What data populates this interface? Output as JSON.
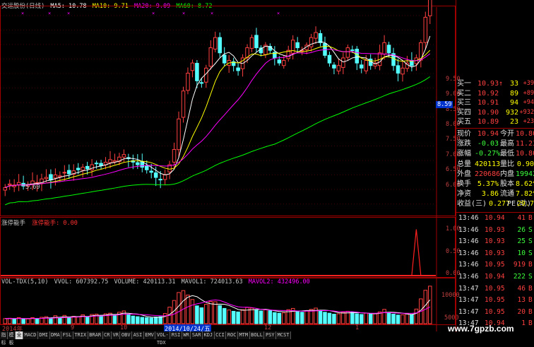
{
  "title": "交运股份(日线)",
  "ma_legend": [
    {
      "label": "MA5: 10.78",
      "color": "#ffffff"
    },
    {
      "label": "MA10: 9.71",
      "color": "#ffff00"
    },
    {
      "label": "MA20: 9.09",
      "color": "#ff00ff"
    },
    {
      "label": "MA60: 8.72",
      "color": "#00ff00"
    }
  ],
  "price_axis": [
    "9.50",
    "9.00",
    "8.50",
    "8.00",
    "7.50",
    "7.00",
    "6.50",
    "6.00"
  ],
  "current_price_tag": "8.59",
  "low_label": "5.69",
  "indicator_title": "涨停能手",
  "indicator_legend": "涨停能手: 0.00",
  "indicator_axis": [
    "1.00",
    "0.50",
    "0.00"
  ],
  "vol_legend": [
    {
      "label": "VOL-TDX(5,10)",
      "color": "#c8c8c8"
    },
    {
      "label": "VVOL: 607392.75",
      "color": "#c8c8c8"
    },
    {
      "label": "VOLUME: 420113.31",
      "color": "#c8c8c8"
    },
    {
      "label": "MAVOL1: 724013.63",
      "color": "#c8c8c8"
    },
    {
      "label": "MAVOL2: 432496.00",
      "color": "#ff00ff"
    }
  ],
  "vol_axis": [
    "10000",
    "5000"
  ],
  "date_axis": {
    "year": "2014年",
    "m9": "9",
    "m10": "10",
    "cursor": "2014/10/24/五",
    "m12": "12",
    "m1": "1"
  },
  "bid_ask": [
    {
      "label": "买一",
      "price": "10.93",
      "arrow": "↑",
      "vol": "33",
      "chg": "+39"
    },
    {
      "label": "买二",
      "price": "10.92",
      "arrow": "",
      "vol": "89",
      "chg": "+89"
    },
    {
      "label": "买三",
      "price": "10.91",
      "arrow": "",
      "vol": "94",
      "chg": "+94"
    },
    {
      "label": "买四",
      "price": "10.90",
      "arrow": "",
      "vol": "932",
      "chg": "+932"
    },
    {
      "label": "买五",
      "price": "10.89",
      "arrow": "",
      "vol": "23",
      "chg": "+23"
    }
  ],
  "stats": [
    {
      "l1": "现价",
      "v1": "10.94",
      "l2": "今开",
      "v2": "10.80"
    },
    {
      "l1": "涨跌",
      "v1": "-0.03",
      "l2": "最高",
      "v2": "11.23"
    },
    {
      "l1": "涨幅",
      "v1": "-0.27%",
      "l2": "最低",
      "v2": "10.80"
    },
    {
      "l1": "总量",
      "v1": "420113",
      "l2": "量比",
      "v2": "0.90"
    },
    {
      "l1": "外盘",
      "v1": "220686",
      "l2": "内盘",
      "v2": "199427"
    },
    {
      "l1": "换手",
      "v1": "5.37%",
      "l2": "股本",
      "v2": "8.62亿"
    },
    {
      "l1": "净资",
      "v1": "3.86",
      "l2": "流通",
      "v2": "7.82亿"
    },
    {
      "l1": "收益(三)",
      "v1": "0.277",
      "l2": "PE(动)",
      "v2": "29.7"
    }
  ],
  "ticks": [
    {
      "time": "13:46",
      "price": "10.94",
      "vol": "41",
      "side": "B"
    },
    {
      "time": "13:46",
      "price": "10.93",
      "vol": "26",
      "side": "S"
    },
    {
      "time": "13:46",
      "price": "10.93",
      "vol": "25",
      "side": "S"
    },
    {
      "time": "13:46",
      "price": "10.93",
      "vol": "10",
      "side": "S"
    },
    {
      "time": "13:46",
      "price": "10.95",
      "vol": "919",
      "side": "B"
    },
    {
      "time": "13:46",
      "price": "10.94",
      "vol": "222",
      "side": "S"
    },
    {
      "time": "13:47",
      "price": "10.95",
      "vol": "46",
      "side": "B"
    },
    {
      "time": "13:47",
      "price": "10.95",
      "vol": "13",
      "side": "B"
    },
    {
      "time": "13:47",
      "price": "10.95",
      "vol": "20",
      "side": "B"
    },
    {
      "time": "13:47",
      "price": "10.94",
      "vol": "1",
      "side": "B"
    }
  ],
  "tabs": [
    "指标",
    "模板",
    "全部",
    "MACD",
    "DMI",
    "DMA",
    "FSL",
    "TRIX",
    "BRAR",
    "CR",
    "VR",
    "OBV",
    "ASI",
    "EMV",
    "VOL-TDX",
    "RSI",
    "WR",
    "SAR",
    "KDJ",
    "CCI",
    "ROC",
    "MTM",
    "BOLL",
    "PSY",
    "MCST"
  ],
  "active_tab": "全部",
  "watermark": "www.7gpzb.com",
  "colors": {
    "up": "#ff4040",
    "down": "#54ffff",
    "ma5": "#ffffff",
    "ma10": "#ffff00",
    "ma20": "#ff00ff",
    "ma60": "#00ff00",
    "frame": "#a00000"
  },
  "chart_data": {
    "type": "candlestick",
    "ma_periods": [
      5,
      10,
      20,
      60
    ],
    "closes": [
      6.15,
      6.22,
      6.2,
      6.25,
      6.18,
      6.2,
      6.28,
      6.25,
      6.32,
      6.35,
      6.3,
      6.4,
      6.38,
      6.45,
      6.42,
      6.48,
      6.5,
      6.55,
      6.52,
      6.6,
      6.62,
      6.58,
      6.65,
      6.7,
      6.68,
      6.75,
      6.8,
      6.72,
      6.65,
      6.6,
      6.55,
      6.5,
      6.45,
      6.35,
      6.3,
      6.4,
      6.6,
      6.9,
      7.5,
      8.05,
      8.4,
      8.6,
      8.25,
      8.2,
      8.5,
      8.9,
      9.1,
      8.8,
      8.6,
      8.65,
      8.55,
      8.45,
      8.7,
      8.9,
      9.1,
      8.9,
      8.8,
      8.95,
      8.85,
      8.7,
      8.6,
      8.65,
      8.85,
      9.05,
      8.9,
      8.85,
      8.95,
      9.1,
      9.2,
      9.0,
      8.75,
      8.6,
      8.5,
      8.55,
      8.7,
      8.9,
      8.85,
      8.6,
      8.5,
      8.65,
      8.55,
      8.6,
      8.8,
      9.0,
      8.8,
      8.55,
      8.4,
      8.5,
      8.6,
      8.55,
      8.7,
      9.0,
      9.5,
      9.9
    ],
    "ylim": [
      5.6,
      9.7
    ],
    "volume": [
      1600,
      1700,
      1500,
      1900,
      1400,
      1500,
      1900,
      1600,
      2000,
      2200,
      1600,
      2500,
      1900,
      2600,
      2000,
      2300,
      2200,
      2800,
      2100,
      2900,
      3000,
      2400,
      3100,
      3300,
      2600,
      3600,
      4000,
      2900,
      2400,
      2200,
      2000,
      1900,
      1800,
      2100,
      2200,
      3200,
      5200,
      7300,
      9800,
      10400,
      9000,
      7600,
      5600,
      5000,
      6100,
      7000,
      6900,
      5700,
      4800,
      4300,
      3900,
      3700,
      4400,
      5100,
      4900,
      4300,
      4000,
      4400,
      4100,
      3500,
      3300,
      3400,
      4400,
      4800,
      3900,
      3600,
      4000,
      4500,
      4900,
      4200,
      3600,
      3300,
      3000,
      3100,
      3600,
      3900,
      3600,
      3100,
      2900,
      3300,
      3100,
      3200,
      3700,
      4500,
      3500,
      3000,
      2700,
      2800,
      3100,
      2900,
      4600,
      7800,
      10500,
      11800
    ],
    "vol_ylim": [
      0,
      12000
    ],
    "indicator": [
      0,
      0,
      0,
      0,
      0,
      0,
      0,
      0,
      0,
      0,
      0,
      0,
      0,
      0,
      0,
      0,
      0,
      0,
      0,
      0,
      0,
      0,
      0,
      0,
      0,
      0,
      0,
      0,
      0,
      0,
      0,
      0,
      0,
      0,
      0,
      0,
      0,
      0,
      0,
      0,
      0,
      0,
      0,
      0,
      0,
      0,
      0,
      0,
      0,
      0,
      0,
      0,
      0,
      0,
      0,
      0,
      0,
      0,
      0,
      0,
      0,
      0,
      0,
      0,
      0,
      0,
      0,
      0,
      0,
      0,
      0,
      0,
      0,
      0,
      0,
      0,
      0,
      0,
      0,
      0,
      0,
      0,
      0,
      0,
      0,
      0,
      0,
      0,
      0,
      0,
      1,
      0,
      0,
      0
    ],
    "indicator_ylim": [
      0,
      1.1
    ]
  }
}
